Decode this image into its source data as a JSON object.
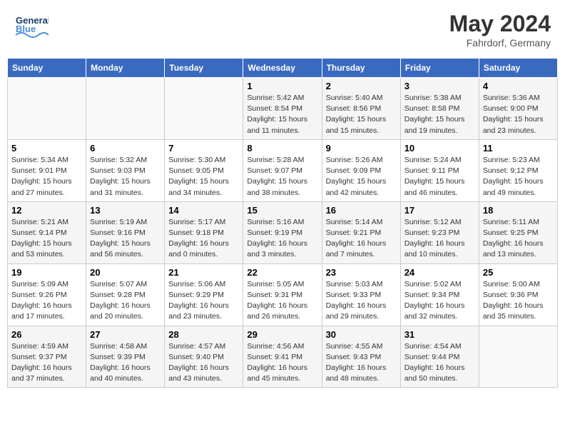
{
  "header": {
    "logo_general": "General",
    "logo_blue": "Blue",
    "month_year": "May 2024",
    "location": "Fahrdorf, Germany"
  },
  "weekdays": [
    "Sunday",
    "Monday",
    "Tuesday",
    "Wednesday",
    "Thursday",
    "Friday",
    "Saturday"
  ],
  "weeks": [
    [
      {
        "day": "",
        "info": ""
      },
      {
        "day": "",
        "info": ""
      },
      {
        "day": "",
        "info": ""
      },
      {
        "day": "1",
        "info": "Sunrise: 5:42 AM\nSunset: 8:54 PM\nDaylight: 15 hours\nand 11 minutes."
      },
      {
        "day": "2",
        "info": "Sunrise: 5:40 AM\nSunset: 8:56 PM\nDaylight: 15 hours\nand 15 minutes."
      },
      {
        "day": "3",
        "info": "Sunrise: 5:38 AM\nSunset: 8:58 PM\nDaylight: 15 hours\nand 19 minutes."
      },
      {
        "day": "4",
        "info": "Sunrise: 5:36 AM\nSunset: 9:00 PM\nDaylight: 15 hours\nand 23 minutes."
      }
    ],
    [
      {
        "day": "5",
        "info": "Sunrise: 5:34 AM\nSunset: 9:01 PM\nDaylight: 15 hours\nand 27 minutes."
      },
      {
        "day": "6",
        "info": "Sunrise: 5:32 AM\nSunset: 9:03 PM\nDaylight: 15 hours\nand 31 minutes."
      },
      {
        "day": "7",
        "info": "Sunrise: 5:30 AM\nSunset: 9:05 PM\nDaylight: 15 hours\nand 34 minutes."
      },
      {
        "day": "8",
        "info": "Sunrise: 5:28 AM\nSunset: 9:07 PM\nDaylight: 15 hours\nand 38 minutes."
      },
      {
        "day": "9",
        "info": "Sunrise: 5:26 AM\nSunset: 9:09 PM\nDaylight: 15 hours\nand 42 minutes."
      },
      {
        "day": "10",
        "info": "Sunrise: 5:24 AM\nSunset: 9:11 PM\nDaylight: 15 hours\nand 46 minutes."
      },
      {
        "day": "11",
        "info": "Sunrise: 5:23 AM\nSunset: 9:12 PM\nDaylight: 15 hours\nand 49 minutes."
      }
    ],
    [
      {
        "day": "12",
        "info": "Sunrise: 5:21 AM\nSunset: 9:14 PM\nDaylight: 15 hours\nand 53 minutes."
      },
      {
        "day": "13",
        "info": "Sunrise: 5:19 AM\nSunset: 9:16 PM\nDaylight: 15 hours\nand 56 minutes."
      },
      {
        "day": "14",
        "info": "Sunrise: 5:17 AM\nSunset: 9:18 PM\nDaylight: 16 hours\nand 0 minutes."
      },
      {
        "day": "15",
        "info": "Sunrise: 5:16 AM\nSunset: 9:19 PM\nDaylight: 16 hours\nand 3 minutes."
      },
      {
        "day": "16",
        "info": "Sunrise: 5:14 AM\nSunset: 9:21 PM\nDaylight: 16 hours\nand 7 minutes."
      },
      {
        "day": "17",
        "info": "Sunrise: 5:12 AM\nSunset: 9:23 PM\nDaylight: 16 hours\nand 10 minutes."
      },
      {
        "day": "18",
        "info": "Sunrise: 5:11 AM\nSunset: 9:25 PM\nDaylight: 16 hours\nand 13 minutes."
      }
    ],
    [
      {
        "day": "19",
        "info": "Sunrise: 5:09 AM\nSunset: 9:26 PM\nDaylight: 16 hours\nand 17 minutes."
      },
      {
        "day": "20",
        "info": "Sunrise: 5:07 AM\nSunset: 9:28 PM\nDaylight: 16 hours\nand 20 minutes."
      },
      {
        "day": "21",
        "info": "Sunrise: 5:06 AM\nSunset: 9:29 PM\nDaylight: 16 hours\nand 23 minutes."
      },
      {
        "day": "22",
        "info": "Sunrise: 5:05 AM\nSunset: 9:31 PM\nDaylight: 16 hours\nand 26 minutes."
      },
      {
        "day": "23",
        "info": "Sunrise: 5:03 AM\nSunset: 9:33 PM\nDaylight: 16 hours\nand 29 minutes."
      },
      {
        "day": "24",
        "info": "Sunrise: 5:02 AM\nSunset: 9:34 PM\nDaylight: 16 hours\nand 32 minutes."
      },
      {
        "day": "25",
        "info": "Sunrise: 5:00 AM\nSunset: 9:36 PM\nDaylight: 16 hours\nand 35 minutes."
      }
    ],
    [
      {
        "day": "26",
        "info": "Sunrise: 4:59 AM\nSunset: 9:37 PM\nDaylight: 16 hours\nand 37 minutes."
      },
      {
        "day": "27",
        "info": "Sunrise: 4:58 AM\nSunset: 9:39 PM\nDaylight: 16 hours\nand 40 minutes."
      },
      {
        "day": "28",
        "info": "Sunrise: 4:57 AM\nSunset: 9:40 PM\nDaylight: 16 hours\nand 43 minutes."
      },
      {
        "day": "29",
        "info": "Sunrise: 4:56 AM\nSunset: 9:41 PM\nDaylight: 16 hours\nand 45 minutes."
      },
      {
        "day": "30",
        "info": "Sunrise: 4:55 AM\nSunset: 9:43 PM\nDaylight: 16 hours\nand 48 minutes."
      },
      {
        "day": "31",
        "info": "Sunrise: 4:54 AM\nSunset: 9:44 PM\nDaylight: 16 hours\nand 50 minutes."
      },
      {
        "day": "",
        "info": ""
      }
    ]
  ]
}
